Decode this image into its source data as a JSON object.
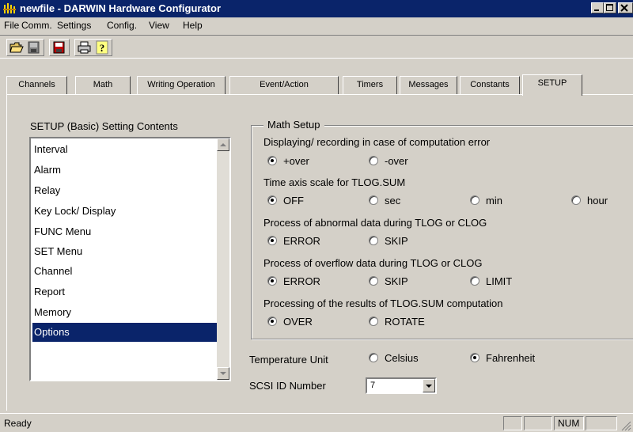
{
  "window": {
    "title": "newfile - DARWIN Hardware Configurator"
  },
  "menu": [
    "File",
    "Comm.",
    "Settings",
    "Config.",
    "View",
    "Help"
  ],
  "toolbar_icons": [
    "open-folder-icon",
    "save-icon",
    "transfer-icon",
    "print-icon",
    "help-icon"
  ],
  "tabs": [
    "Channels",
    "Math",
    "Writing Operation",
    "Event/Action",
    "Timers",
    "Messages",
    "Constants",
    "SETUP"
  ],
  "active_tab": "SETUP",
  "left": {
    "label": "SETUP (Basic) Setting Contents",
    "items": [
      "Interval",
      "Alarm",
      "Relay",
      "Key Lock/ Display",
      "FUNC Menu",
      "SET Menu",
      "Channel",
      "Report",
      "Memory",
      "Options"
    ],
    "selected": "Options"
  },
  "math_setup": {
    "title": "Math Setup",
    "q1": {
      "label": "Displaying/ recording in case of computation error",
      "options": [
        "+over",
        "-over"
      ],
      "selected": "+over"
    },
    "q2": {
      "label": "Time axis scale for TLOG.SUM",
      "options": [
        "OFF",
        "sec",
        "min",
        "hour"
      ],
      "selected": "OFF"
    },
    "q3": {
      "label": "Process of abnormal data during TLOG or CLOG",
      "options": [
        "ERROR",
        "SKIP"
      ],
      "selected": "ERROR"
    },
    "q4": {
      "label": "Process of overflow data during TLOG or CLOG",
      "options": [
        "ERROR",
        "SKIP",
        "LIMIT"
      ],
      "selected": "ERROR"
    },
    "q5": {
      "label": "Processing of the results of TLOG.SUM computation",
      "options": [
        "OVER",
        "ROTATE"
      ],
      "selected": "OVER"
    }
  },
  "temperature": {
    "label": "Temperature Unit",
    "options": [
      "Celsius",
      "Fahrenheit"
    ],
    "selected": "Fahrenheit"
  },
  "scsi": {
    "label": "SCSI ID Number",
    "value": "7"
  },
  "status": {
    "text": "Ready",
    "num": "NUM"
  },
  "colors": {
    "titlebar": "#0a246a",
    "face": "#d4d0c8",
    "selection": "#0a246a"
  }
}
